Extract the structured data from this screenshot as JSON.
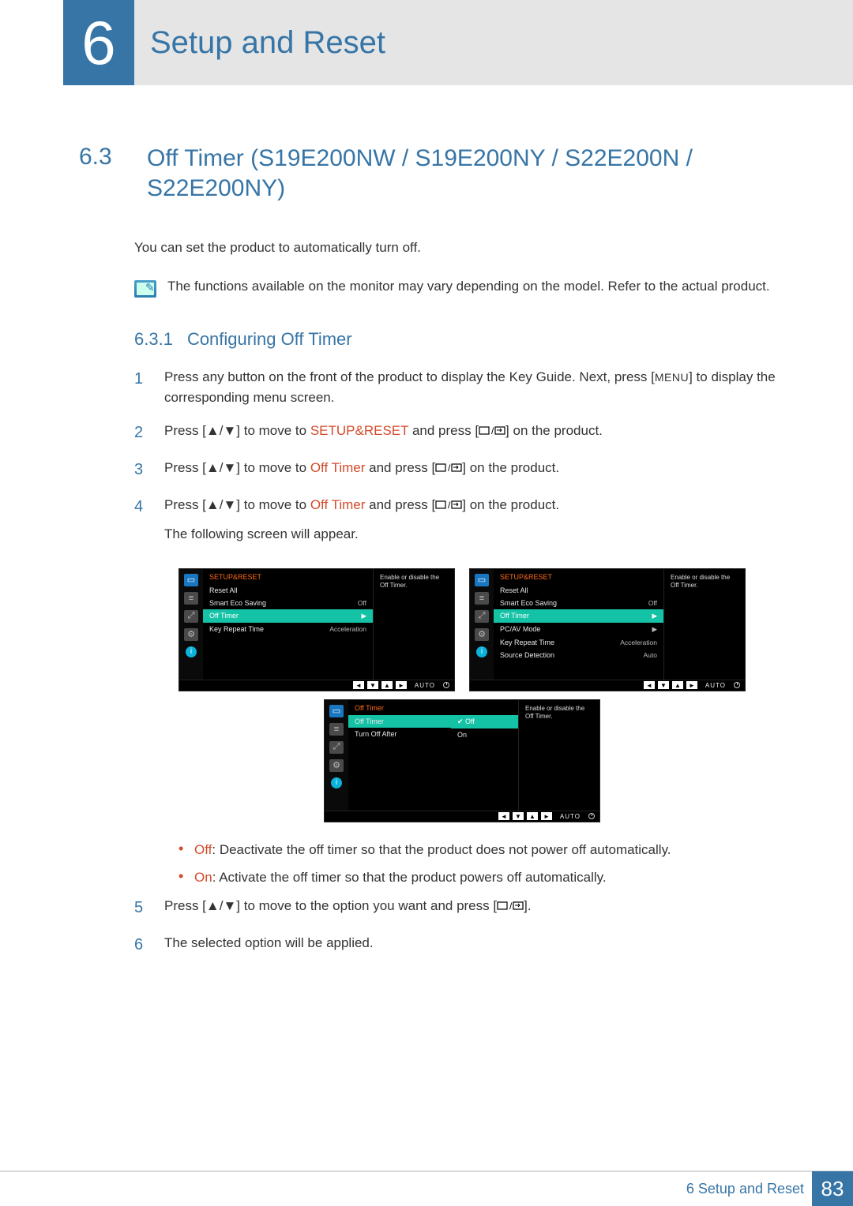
{
  "header": {
    "chapter_number": "6",
    "chapter_title": "Setup and Reset"
  },
  "section": {
    "number": "6.3",
    "title": "Off Timer (S19E200NW / S19E200NY / S22E200N / S22E200NY)"
  },
  "intro": "You can set the product to automatically turn off.",
  "note": "The functions available on the monitor may vary depending on the model. Refer to the actual product.",
  "subsection": {
    "number": "6.3.1",
    "title": "Configuring Off Timer"
  },
  "steps": {
    "s1a": "Press any button on the front of the product to display the Key Guide. Next, press [",
    "s1menu": "MENU",
    "s1b": "] to display the corresponding menu screen.",
    "s2a": "Press [",
    "s2b": "] to move to ",
    "s2c": "SETUP&RESET",
    "s2d": " and press [",
    "s2e": "] on the product.",
    "s3a": "Press [",
    "s3b": "] to move to ",
    "s3c": "Off Timer",
    "s3d": " and press [",
    "s3e": "] on the product.",
    "s4a": "Press [",
    "s4b": "] to move to ",
    "s4c": "Off Timer",
    "s4d": " and press [",
    "s4e": "] on the product.",
    "s4f": "The following screen will appear.",
    "s5a": "Press [",
    "s5b": "] to move to the option you want and press [",
    "s5c": "].",
    "s6": "The selected option will be applied."
  },
  "bullets": {
    "off_label": "Off",
    "off_text": ": Deactivate the off timer so that the product does not power off automatically.",
    "on_label": "On",
    "on_text": ": Activate the off timer so that the product powers off automatically."
  },
  "osd": {
    "header": "SETUP&RESET",
    "desc": "Enable or disable the Off Timer.",
    "auto": "AUTO",
    "panel1": {
      "rows": [
        {
          "label": "Reset All",
          "value": ""
        },
        {
          "label": "Smart Eco Saving",
          "value": "Off"
        },
        {
          "label": "Off Timer",
          "value": "▶"
        },
        {
          "label": "Key Repeat Time",
          "value": "Acceleration"
        }
      ],
      "selected": 2
    },
    "panel2": {
      "rows": [
        {
          "label": "Reset All",
          "value": ""
        },
        {
          "label": "Smart Eco Saving",
          "value": "Off"
        },
        {
          "label": "Off Timer",
          "value": "▶"
        },
        {
          "label": "PC/AV Mode",
          "value": "▶"
        },
        {
          "label": "Key Repeat Time",
          "value": "Acceleration"
        },
        {
          "label": "Source Detection",
          "value": "Auto"
        }
      ],
      "selected": 2
    },
    "panel3": {
      "header": "Off Timer",
      "left_rows": [
        "Off Timer",
        "Turn Off After"
      ],
      "left_selected": 0,
      "options": [
        "Off",
        "On"
      ],
      "opt_selected": 0
    }
  },
  "footer": {
    "label": "6 Setup and Reset",
    "page": "83"
  }
}
